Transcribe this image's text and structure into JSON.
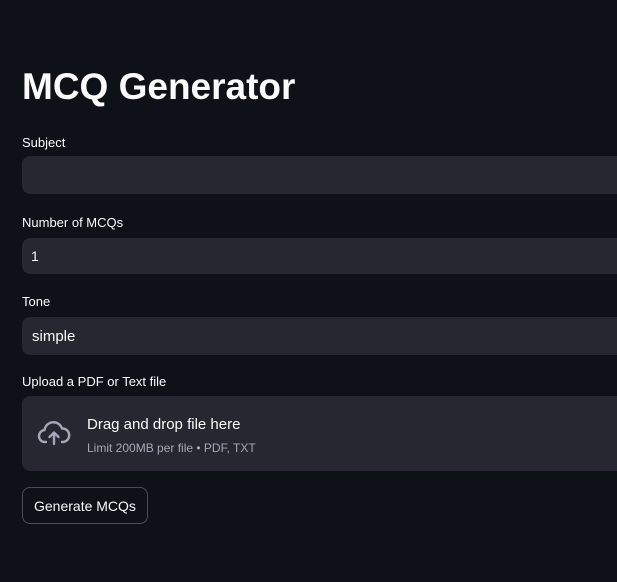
{
  "page": {
    "title": "MCQ Generator"
  },
  "form": {
    "subject": {
      "label": "Subject",
      "value": ""
    },
    "num_mcqs": {
      "label": "Number of MCQs",
      "value": "1"
    },
    "tone": {
      "label": "Tone",
      "value": "simple"
    },
    "upload": {
      "label": "Upload a PDF or Text file",
      "dropzone_title": "Drag and drop file here",
      "dropzone_hint": "Limit 200MB per file • PDF, TXT",
      "icon": "cloud-upload-icon"
    },
    "submit_label": "Generate MCQs"
  },
  "colors": {
    "background": "#0e1117",
    "input_bg": "#262730",
    "text": "#fafafa",
    "muted_text": "#a3a8b8",
    "button_border": "#4a4d57"
  }
}
